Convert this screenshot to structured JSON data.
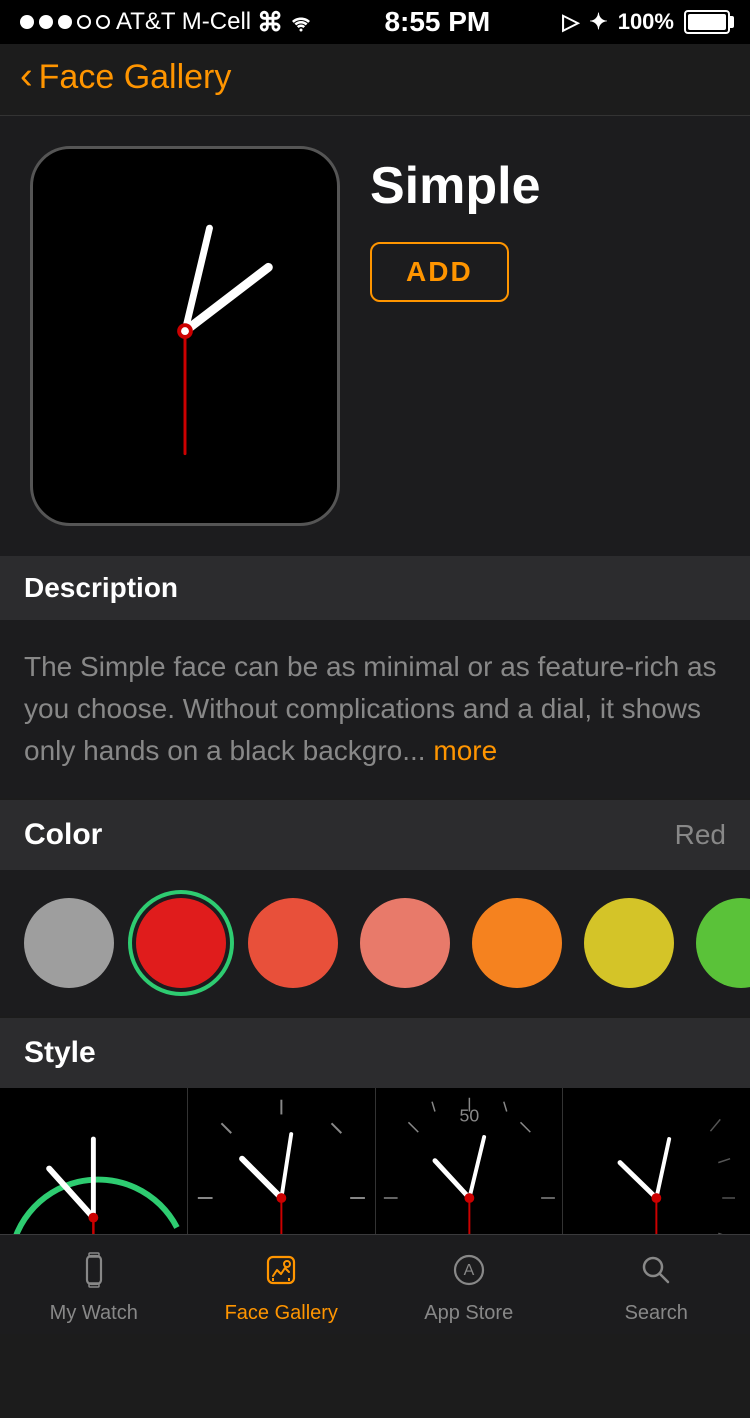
{
  "status": {
    "carrier": "AT&T M-Cell",
    "time": "8:55 PM",
    "battery": "100%"
  },
  "nav": {
    "back_label": "Face Gallery"
  },
  "hero": {
    "face_name": "Simple",
    "add_label": "ADD"
  },
  "description": {
    "section_label": "Description",
    "text": "The Simple face can be as minimal or as feature-rich as you choose. Without complications and a dial, it shows only hands on a black backgro...",
    "more_label": "more"
  },
  "color": {
    "section_label": "Color",
    "current_value": "Red",
    "options": [
      {
        "name": "silver",
        "hex": "#9e9e9e",
        "selected": false
      },
      {
        "name": "red",
        "hex": "#e01c1c",
        "selected": true
      },
      {
        "name": "coral",
        "hex": "#e8503a",
        "selected": false
      },
      {
        "name": "salmon",
        "hex": "#e87a6a",
        "selected": false
      },
      {
        "name": "orange",
        "hex": "#f5821f",
        "selected": false
      },
      {
        "name": "yellow",
        "hex": "#d4c428",
        "selected": false
      },
      {
        "name": "green",
        "hex": "#5ac239",
        "selected": false
      }
    ]
  },
  "style": {
    "section_label": "Style"
  },
  "tabs": [
    {
      "id": "my-watch",
      "label": "My Watch",
      "active": false
    },
    {
      "id": "face-gallery",
      "label": "Face Gallery",
      "active": true
    },
    {
      "id": "app-store",
      "label": "App Store",
      "active": false
    },
    {
      "id": "search",
      "label": "Search",
      "active": false
    }
  ],
  "colors": {
    "accent": "#FF9500",
    "selected_ring": "#2ecc71"
  }
}
